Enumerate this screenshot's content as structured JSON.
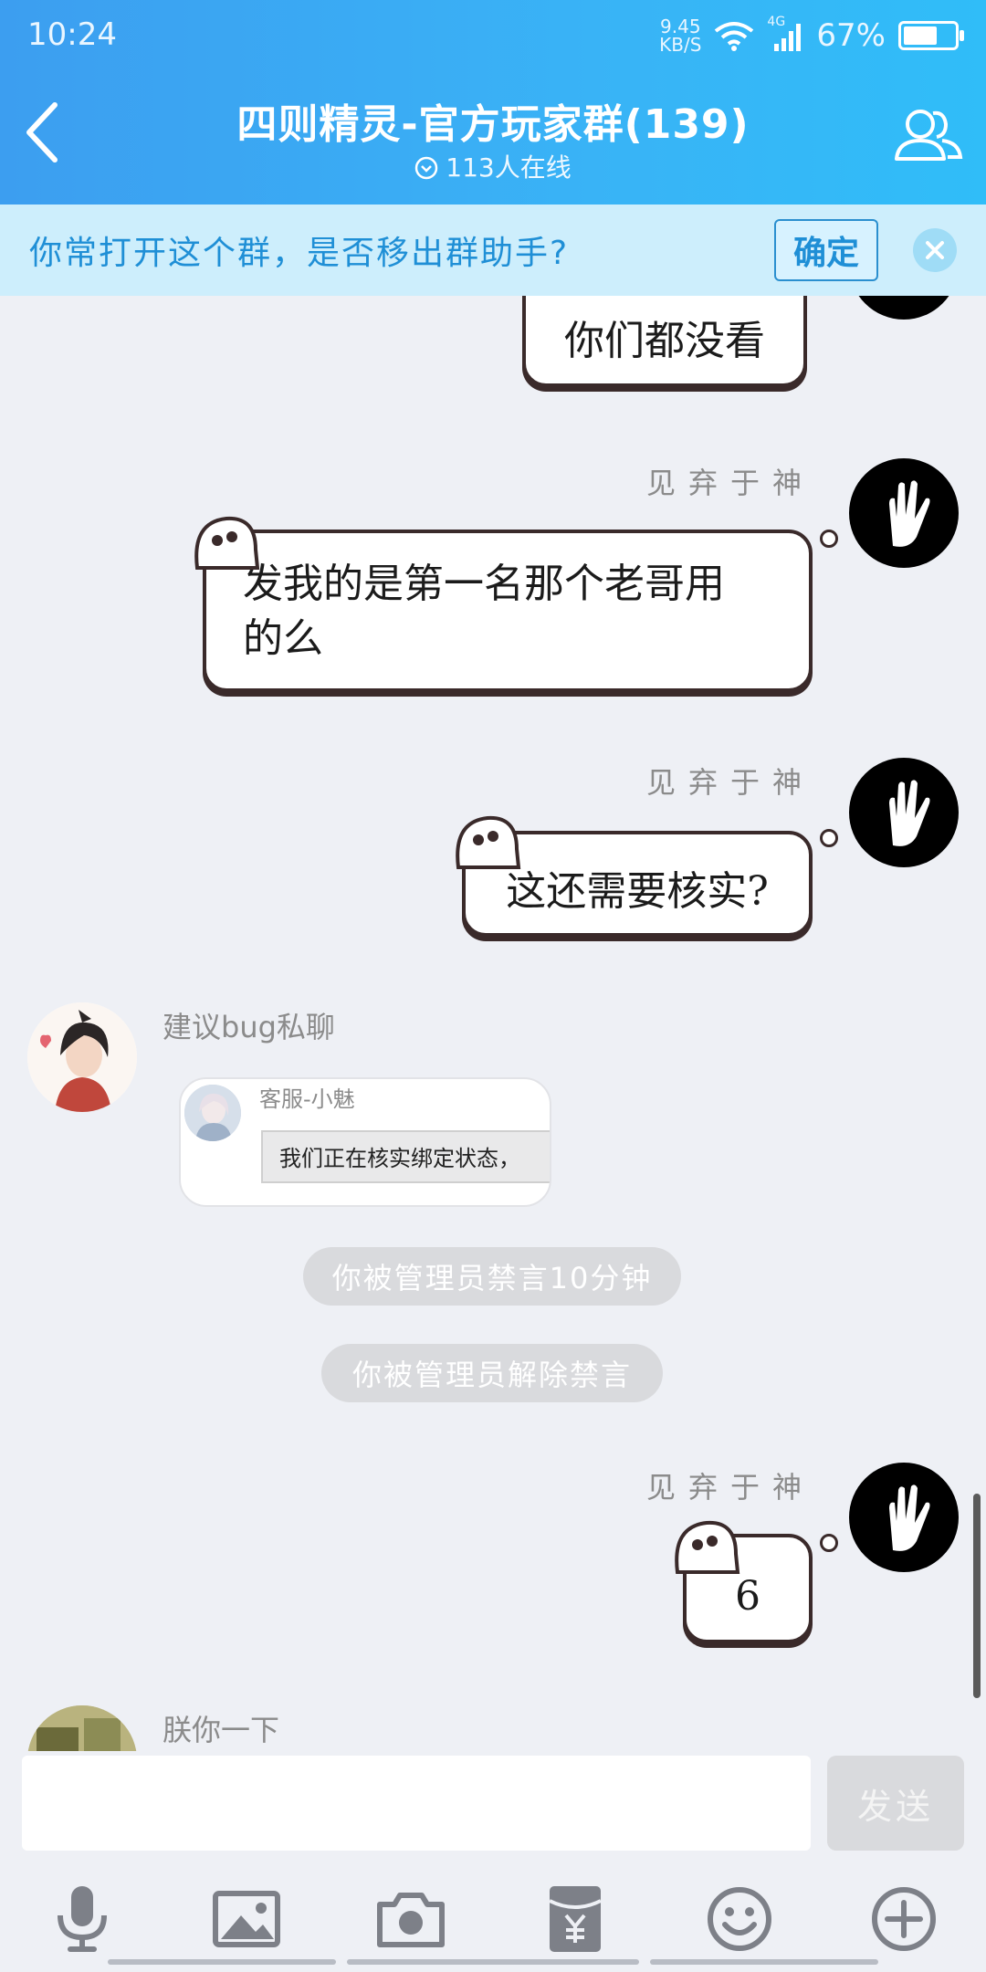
{
  "status": {
    "time": "10:24",
    "speed_value": "9.45",
    "speed_unit": "KB/S",
    "network": "4G",
    "battery": "67%",
    "battery_level": 0.67
  },
  "header": {
    "title": "四则精灵-官方玩家群(139)",
    "online": "113人在线"
  },
  "notice": {
    "text": "你常打开这个群，是否移出群助手?",
    "confirm": "确定"
  },
  "messages": [
    {
      "sender": "",
      "text": "你们都没看"
    },
    {
      "sender": "见弃于神",
      "line1": "发我的是第一名那个老哥用",
      "line2": "的么"
    },
    {
      "sender": "见弃于神",
      "text": "这还需要核实?"
    },
    {
      "sender": "建议bug私聊",
      "card_name": "客服-小魅",
      "card_text": "我们正在核实绑定状态，"
    },
    {
      "sender": "见弃于神",
      "text": "6"
    },
    {
      "sender": "朕你一下"
    }
  ],
  "system_tips": [
    "你被管理员禁言10分钟",
    "你被管理员解除禁言"
  ],
  "input": {
    "placeholder": "",
    "send": "发送"
  },
  "toolbar": [
    "microphone-icon",
    "image-icon",
    "camera-icon",
    "red-packet-icon",
    "emoji-icon",
    "plus-icon"
  ],
  "colors": {
    "header": "#3aa8f4",
    "notice_bg": "#cdeefc",
    "notice_text": "#1f8fd6",
    "chat_bg": "#eef0f5"
  }
}
